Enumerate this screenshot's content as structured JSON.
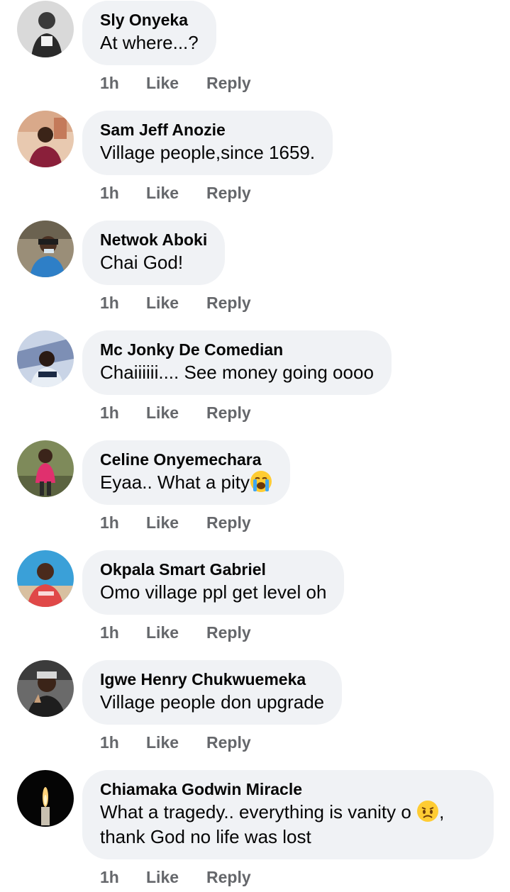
{
  "comments": [
    {
      "author": "Sly Onyeka",
      "text": "At where...?",
      "time": "1h",
      "like_label": "Like",
      "reply_label": "Reply"
    },
    {
      "author": "Sam Jeff Anozie",
      "text": "Village people,since 1659.",
      "time": "1h",
      "like_label": "Like",
      "reply_label": "Reply"
    },
    {
      "author": "Netwok Aboki",
      "text": "Chai God!",
      "time": "1h",
      "like_label": "Like",
      "reply_label": "Reply"
    },
    {
      "author": "Mc Jonky De Comedian",
      "text": "Chaiiiiii.... See money going oooo",
      "time": "1h",
      "like_label": "Like",
      "reply_label": "Reply"
    },
    {
      "author": "Celine Onyemechara",
      "text": "Eyaa.. What a pity",
      "emoji": "loudly-crying-face-emoji",
      "time": "1h",
      "like_label": "Like",
      "reply_label": "Reply"
    },
    {
      "author": "Okpala Smart Gabriel",
      "text": "Omo village ppl get level oh",
      "time": "1h",
      "like_label": "Like",
      "reply_label": "Reply"
    },
    {
      "author": "Igwe Henry Chukwuemeka",
      "text": "Village people don upgrade",
      "time": "1h",
      "like_label": "Like",
      "reply_label": "Reply"
    },
    {
      "author": "Chiamaka Godwin Miracle",
      "text_line1": "What a tragedy.. everything is vanity o",
      "text_line1_suffix": ",",
      "text_line2": "thank God no life was lost",
      "emoji": "sad-face-emoji",
      "time": "1h",
      "like_label": "Like",
      "reply_label": "Reply"
    }
  ],
  "colors": {
    "bubble_bg": "#f0f2f5",
    "text": "#050505",
    "meta": "#65676b"
  }
}
